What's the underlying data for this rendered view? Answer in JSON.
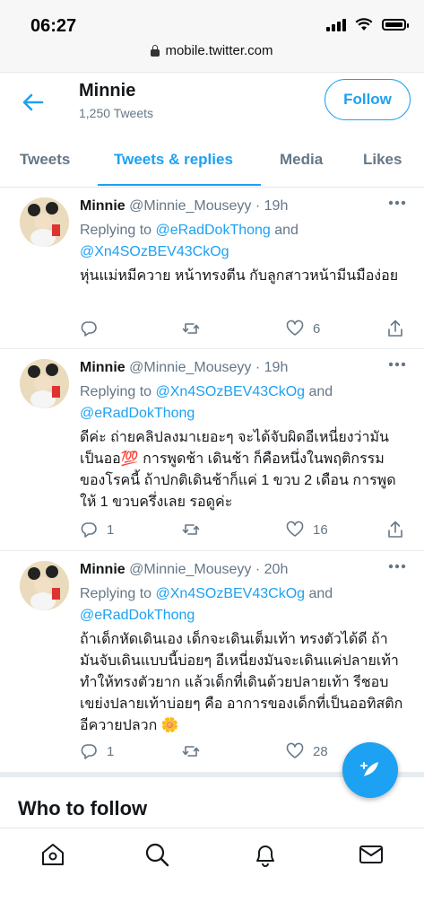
{
  "status_bar": {
    "time": "06:27"
  },
  "browser": {
    "url": "mobile.twitter.com"
  },
  "profile": {
    "name": "Minnie",
    "tweet_count": "1,250 Tweets",
    "follow_label": "Follow"
  },
  "tabs": [
    {
      "label": "Tweets"
    },
    {
      "label": "Tweets & replies"
    },
    {
      "label": "Media"
    },
    {
      "label": "Likes"
    }
  ],
  "tweets": [
    {
      "name": "Minnie",
      "handle": "@Minnie_Mouseyy",
      "sep": "·",
      "time": "19h",
      "replying_prefix": "Replying to ",
      "reply_to_1": "@eRadDokThong",
      "reply_and": " and ",
      "reply_to_2": "@Xn4SOzBEV43CkOg",
      "text": "หุ่นแม่หมีควาย หน้าทรงตีน กับลูกสาวหน้ามีนมือง่อย",
      "replies": "",
      "likes": "6"
    },
    {
      "name": "Minnie",
      "handle": "@Minnie_Mouseyy",
      "sep": "·",
      "time": "19h",
      "replying_prefix": "Replying to ",
      "reply_to_1": "@Xn4SOzBEV43CkOg",
      "reply_and": " and ",
      "reply_to_2": "@eRadDokThong",
      "text": "ดีค่ะ ถ่ายคลิปลงมาเยอะๆ จะได้จับผิดอีเหนี่ยงว่ามันเป็นออ💯 การพูดช้า เดินช้า ก็คือหนึ่งในพฤติกรรมของโรคนี้ ถ้าปกติเดินช้าก็แค่ 1 ขวบ 2 เดือน การพูดให้ 1 ขวบครึ่งเลย รอดูค่ะ",
      "replies": "1",
      "likes": "16"
    },
    {
      "name": "Minnie",
      "handle": "@Minnie_Mouseyy",
      "sep": "·",
      "time": "20h",
      "replying_prefix": "Replying to ",
      "reply_to_1": "@Xn4SOzBEV43CkOg",
      "reply_and": " and ",
      "reply_to_2": "@eRadDokThong",
      "text": "ถ้าเด็กหัดเดินเอง เด็กจะเดินเต็มเท้า ทรงตัวได้ดี ถ้ามันจับเดินแบบนี้บ่อยๆ อีเหนี่ยงมันจะเดินแค่ปลายเท้า ทำให้ทรงตัวยาก แล้วเด็กที่เดินด้วยปลายเท้า รีชอบเขย่งปลายเท้าบ่อยๆ คือ อาการของเด็กที่เป็นออทิสติก อีควายปลวก 🌼",
      "replies": "1",
      "likes": "28"
    }
  ],
  "who_to_follow": {
    "title": "Who to follow"
  },
  "colors": {
    "accent": "#1da1f2",
    "text": "#14171a",
    "muted": "#657786",
    "border": "#e1e8ed"
  }
}
